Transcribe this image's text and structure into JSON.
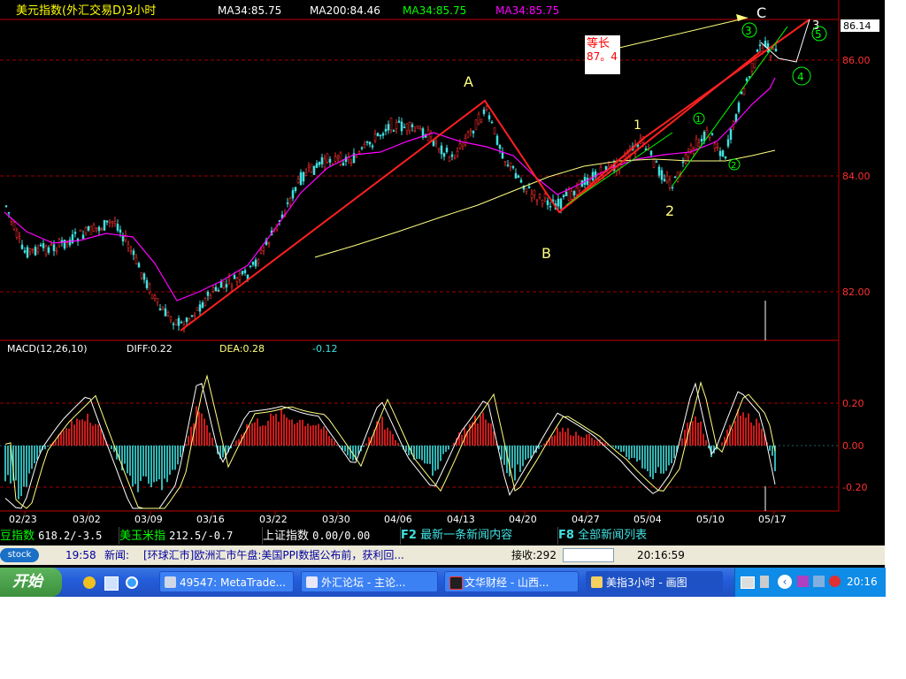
{
  "window_title": "美元指数(外汇交易D)3小时",
  "price_panel": {
    "indicators": [
      {
        "label": "MA34:85.75",
        "color": "#ffffff"
      },
      {
        "label": "MA200:84.46",
        "color": "#ffffff"
      },
      {
        "label": "MA34:85.75",
        "color": "#00ff00"
      },
      {
        "label": "MA34:85.75",
        "color": "#ff00ff"
      }
    ],
    "current_price": "86.14",
    "price_ticks": [
      "86.00",
      "84.00",
      "82.00"
    ],
    "annotation_box": {
      "line1": "等长",
      "line2": "87。4"
    },
    "wave_labels": [
      "A",
      "B",
      "C",
      "1",
      "2",
      "1",
      "2",
      "3",
      "3",
      "4",
      "5"
    ]
  },
  "macd_panel": {
    "title": "MACD(12,26,10)",
    "diff": "DIFF:0.22",
    "dea": "DEA:0.28",
    "macd": "-0.12",
    "ticks": [
      "0.20",
      "0.00",
      "-0.20"
    ]
  },
  "date_axis": [
    "02/23",
    "03/02",
    "03/09",
    "03/16",
    "03/22",
    "03/30",
    "04/06",
    "04/13",
    "04/20",
    "04/27",
    "05/04",
    "05/10",
    "05/17"
  ],
  "ticker_bar": [
    {
      "name": "豆指数",
      "value": "618.2/-3.5"
    },
    {
      "name": "美玉米指",
      "value": "212.5/-0.7"
    },
    {
      "name": "上证指数",
      "value": "0.00/0.00"
    },
    {
      "name": "F2",
      "value": "最新一条新闻内容"
    },
    {
      "name": "F8",
      "value": "全部新闻列表"
    }
  ],
  "news_bar": {
    "logo": "stock",
    "time": "19:58",
    "label": "新闻:",
    "headline": "[环球汇市]欧洲汇市午盘:美国PPI数据公布前，获利回...",
    "receive": "接收:292",
    "clock": "20:16:59"
  },
  "taskbar": {
    "start": "开始",
    "tasks": [
      "49547: MetaTrade...",
      "外汇论坛 - 主论...",
      "文华财经 - 山西...",
      "美指3小时 - 画图"
    ],
    "clock": "20:16"
  },
  "colors": {
    "rise": "#ff3030",
    "fall": "#40e0e0",
    "ma_fast": "#ff00ff",
    "ma_slow": "#ffff80",
    "trend": "#ff2020"
  }
}
